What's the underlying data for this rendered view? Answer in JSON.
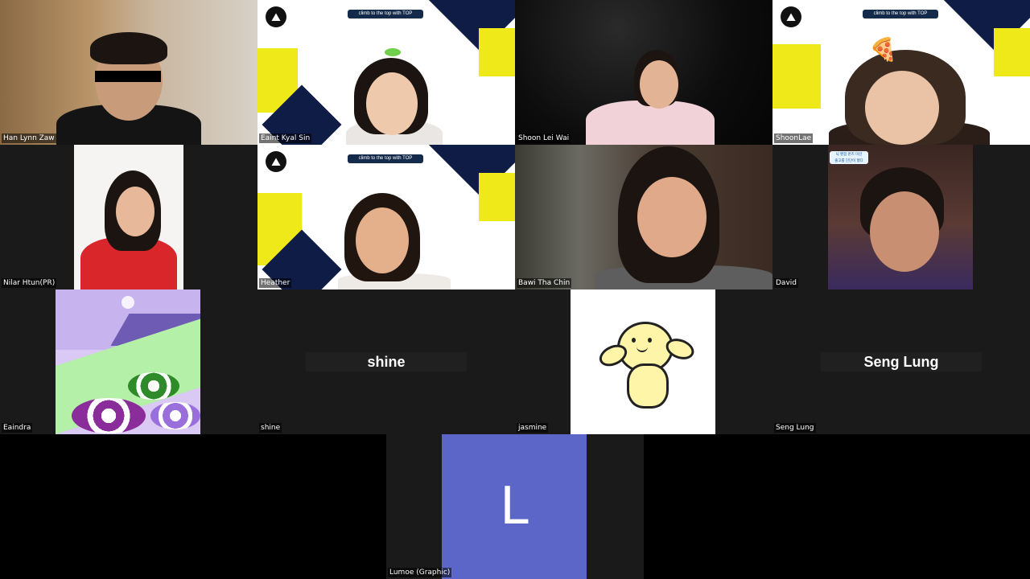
{
  "participants": [
    {
      "name": "Han Lynn Zaw"
    },
    {
      "name": "Eaint Kyal Sin",
      "banner": "climb to the top with TOP"
    },
    {
      "name": "Shoon Lei Wai"
    },
    {
      "name": "ShoonLae",
      "banner": "climb to the top with TOP"
    },
    {
      "name": "Nilar Htun(PR)"
    },
    {
      "name": "Heather",
      "banner": "climb to the top with TOP"
    },
    {
      "name": "Bawi Tha Chin"
    },
    {
      "name": "David",
      "overlay": "닉 펜팜 몬즈 미션\n출고를 단단이 했다"
    },
    {
      "name": "Eaindra"
    },
    {
      "name": "shine",
      "center": "shine"
    },
    {
      "name": "jasmine"
    },
    {
      "name": "Seng Lung",
      "center": "Seng Lung"
    },
    {
      "name": "Lumoe (Graphic)",
      "initial": "L"
    }
  ],
  "colors": {
    "navy": "#0f1c46",
    "yellow": "#f0e91a",
    "avatar_blue": "#5b66c8",
    "tile_bg": "#1a1a1a"
  }
}
